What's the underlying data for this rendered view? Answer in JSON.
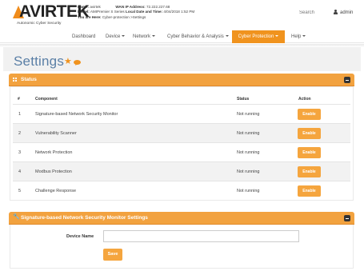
{
  "brand": {
    "name": "AVIRTEK",
    "tagline": "Autonomic Cyber Security"
  },
  "system_info": {
    "name_label": "Name:",
    "name_value": "avirtek",
    "wan_label": "WAN IP Address:",
    "wan_value": "72.222.227.68",
    "model_label": "Model:",
    "model_value": "AMIPremier S Series",
    "datetime_label": "Local Date and Time:",
    "datetime_value": "4/04/2018 1:52 PM",
    "location_label": "You are Here:",
    "location_value": "Cyber-protection >Settings"
  },
  "header": {
    "search_placeholder": "Search",
    "user_name": "admin"
  },
  "nav": {
    "items": [
      {
        "label": "Dashboard",
        "has_caret": false,
        "active": false
      },
      {
        "label": "Device",
        "has_caret": true,
        "active": false
      },
      {
        "label": "Network",
        "has_caret": true,
        "active": false
      },
      {
        "label": "Cyber Behavior & Analysis",
        "has_caret": true,
        "active": false
      },
      {
        "label": "Cyber Protection",
        "has_caret": true,
        "active": true
      },
      {
        "label": "Help",
        "has_caret": true,
        "active": false
      }
    ]
  },
  "page": {
    "title": "Settings"
  },
  "status_panel": {
    "title": "Status",
    "columns": {
      "num": "#",
      "component": "Component",
      "status": "Status",
      "action": "Action"
    },
    "rows": [
      {
        "num": "1",
        "component": "Signature-based Network Security Monitor",
        "status": "Not running",
        "action": "Enable"
      },
      {
        "num": "2",
        "component": "Vulnerability Scanner",
        "status": "Not running",
        "action": "Enable"
      },
      {
        "num": "3",
        "component": "Network Protection",
        "status": "Not running",
        "action": "Enable"
      },
      {
        "num": "4",
        "component": "Modbus Protection",
        "status": "Not running",
        "action": "Enable"
      },
      {
        "num": "5",
        "component": "Challenge Response",
        "status": "Not running",
        "action": "Enable"
      }
    ]
  },
  "settings_panel": {
    "title": "Signature-based Network Security Monitor Settings",
    "device_name_label": "Device Name",
    "device_name_value": "",
    "save_label": "Save"
  },
  "colors": {
    "accent": "#f0931e",
    "panel_header": "#f2a23f",
    "button": "#f5a53e",
    "title_blue": "#5a7fa6"
  }
}
